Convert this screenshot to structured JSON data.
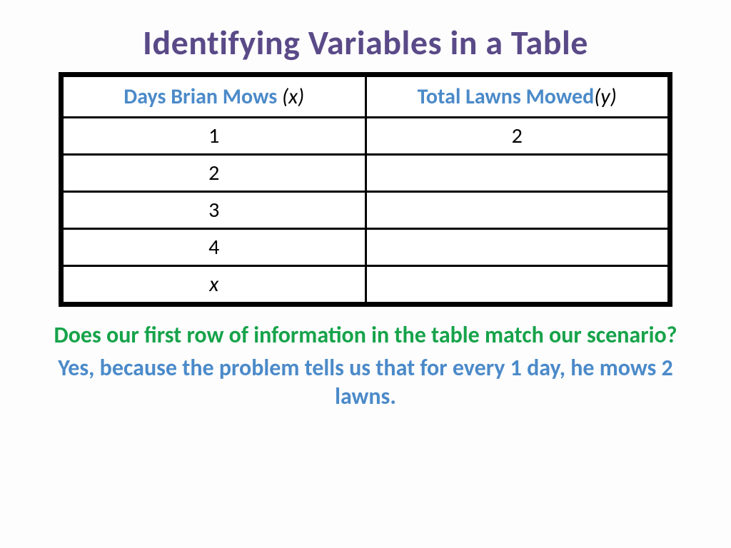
{
  "title": "Identifying Variables in a Table",
  "table": {
    "headers": {
      "col1": {
        "label": "Days Brian Mows ",
        "var": "(x)"
      },
      "col2": {
        "label": "Total Lawns Mowed",
        "var": "(y)"
      }
    },
    "rows": [
      {
        "x": "1",
        "y": "2"
      },
      {
        "x": "2",
        "y": ""
      },
      {
        "x": "3",
        "y": ""
      },
      {
        "x": "4",
        "y": ""
      },
      {
        "x": "x",
        "y": ""
      }
    ]
  },
  "question": "Does our first row of information in the table match our scenario?",
  "answer": "Yes, because the problem tells us that for every 1 day, he mows 2 lawns."
}
